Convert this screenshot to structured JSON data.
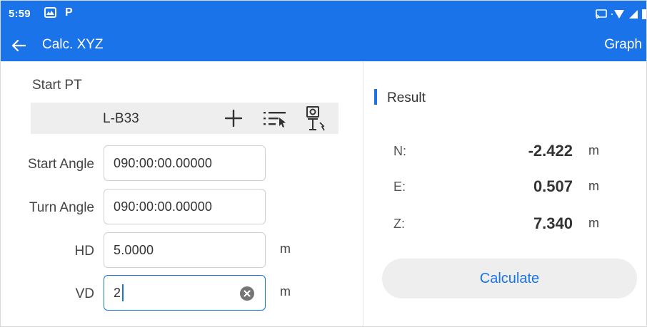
{
  "status_bar": {
    "time": "5:59",
    "notification_icons": [
      "gallery-icon",
      "p-app-icon"
    ],
    "p_glyph": "P",
    "system_icons": [
      "cast-icon",
      "wifi-icon",
      "signal-icon",
      "battery-icon"
    ]
  },
  "app_bar": {
    "title": "Calc. XYZ",
    "action": "Graph",
    "back_icon": "arrow-left-icon"
  },
  "form": {
    "start_pt_label": "Start PT",
    "start_pt_value": "L-B33",
    "start_pt_actions": [
      "add-icon",
      "point-list-icon",
      "survey-point-icon"
    ],
    "fields": [
      {
        "label": "Start Angle",
        "value": "090:00:00.00000",
        "unit": ""
      },
      {
        "label": "Turn Angle",
        "value": "090:00:00.00000",
        "unit": ""
      },
      {
        "label": "HD",
        "value": "5.0000",
        "unit": "m"
      },
      {
        "label": "VD",
        "value": "2",
        "unit": "m"
      }
    ]
  },
  "result": {
    "title": "Result",
    "rows": [
      {
        "label": "N:",
        "value": "-2.422",
        "unit": "m"
      },
      {
        "label": "E:",
        "value": "0.507",
        "unit": "m"
      },
      {
        "label": "Z:",
        "value": "7.340",
        "unit": "m"
      }
    ],
    "button": "Calculate"
  },
  "colors": {
    "primary": "#1a73e8",
    "panel_bg": "#eeeeee"
  }
}
